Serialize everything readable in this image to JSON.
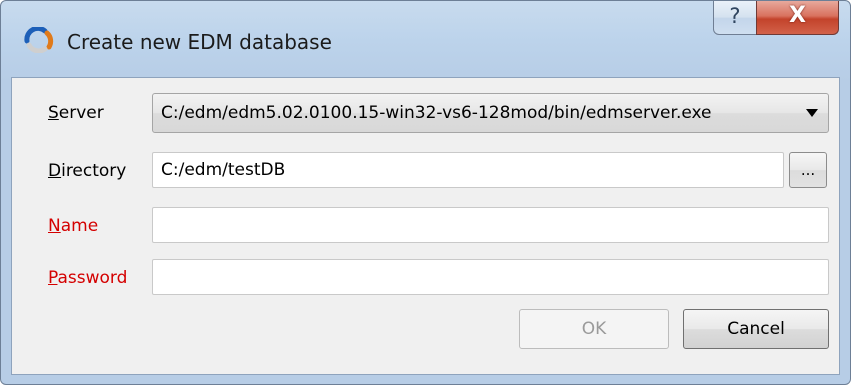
{
  "window": {
    "title": "Create new EDM database",
    "help_label": "?",
    "close_label": "X"
  },
  "form": {
    "server": {
      "label_underline": "S",
      "label_rest": "erver",
      "selected": "C:/edm/edm5.02.0100.15-win32-vs6-128mod/bin/edmserver.exe"
    },
    "directory": {
      "label_underline": "D",
      "label_rest": "irectory",
      "value": "C:/edm/testDB",
      "browse_label": "..."
    },
    "name": {
      "label_underline": "N",
      "label_rest": "ame",
      "value": ""
    },
    "password": {
      "label_underline": "P",
      "label_rest": "assword",
      "value": ""
    }
  },
  "buttons": {
    "ok_label": "OK",
    "cancel_label": "Cancel"
  },
  "colors": {
    "required_label": "#d40000",
    "title_bar": "#bcd3eb",
    "close_button": "#c3432b"
  }
}
